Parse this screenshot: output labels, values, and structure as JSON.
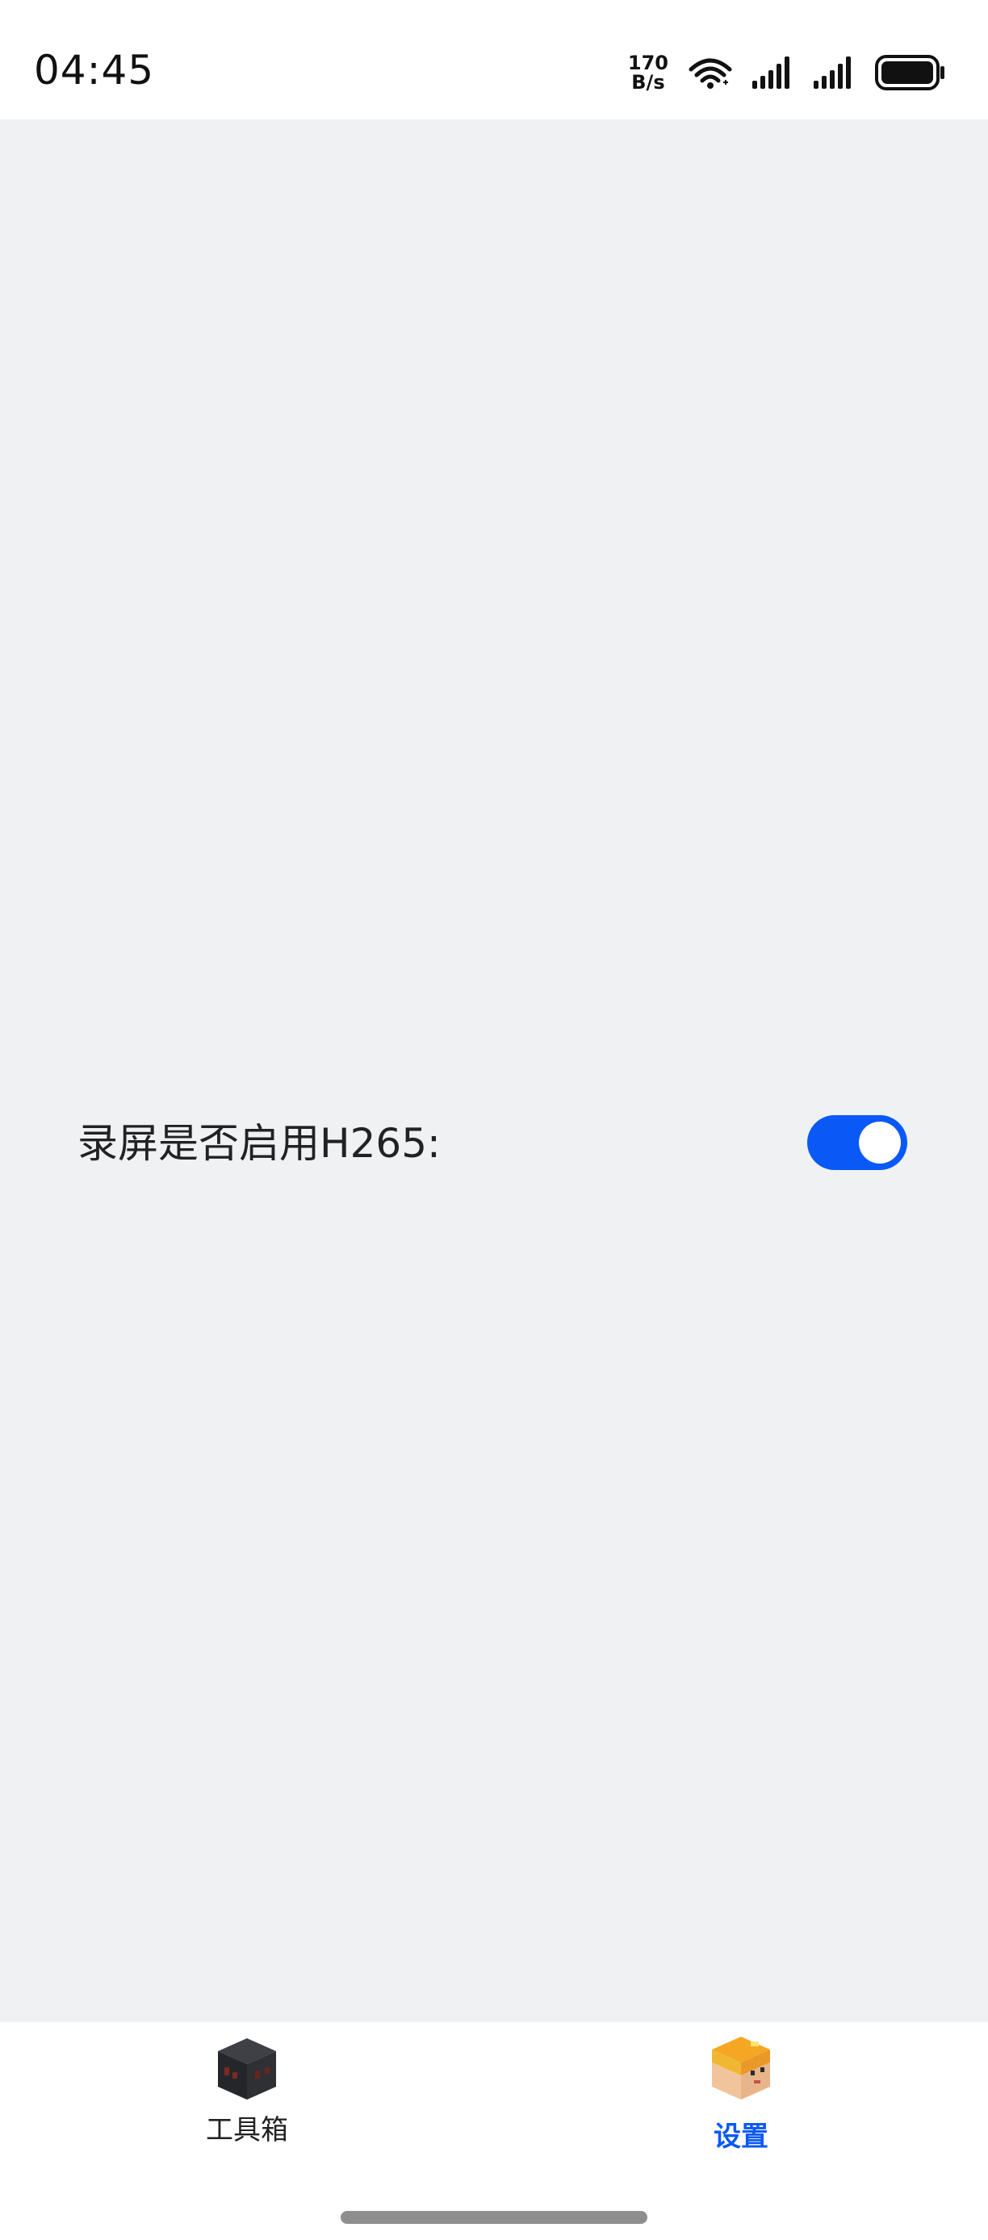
{
  "status_bar": {
    "time": "04:45",
    "netspeed_value": "170",
    "netspeed_unit": "B/s"
  },
  "settings": {
    "h265_label": "录屏是否启用H265:",
    "h265_enabled": true
  },
  "bottom_nav": {
    "tabs": [
      {
        "label": "工具箱",
        "icon": "dark-block-icon",
        "active": false
      },
      {
        "label": "设置",
        "icon": "block-avatar-icon",
        "active": true
      }
    ]
  },
  "colors": {
    "accent": "#0a59f7",
    "background": "#f0f1f3"
  }
}
